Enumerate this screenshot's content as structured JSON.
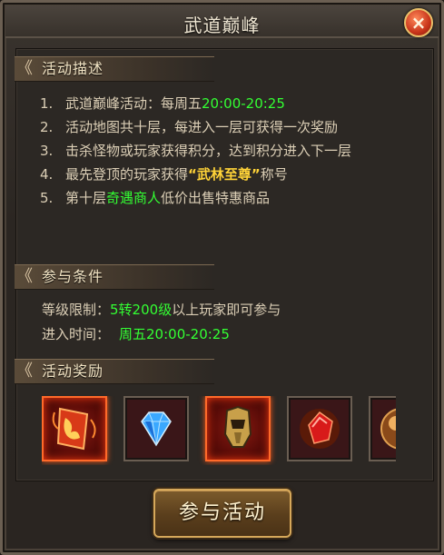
{
  "window": {
    "title": "武道巅峰"
  },
  "sections": {
    "description": "活动描述",
    "conditions": "参与条件",
    "rewards": "活动奖励"
  },
  "description_items": [
    {
      "num": "1.",
      "text": "武道巅峰活动：每周五",
      "highlight": "20:00-20:25",
      "suffix": ""
    },
    {
      "num": "2.",
      "text": "活动地图共十层，每进入一层可获得一次奖励"
    },
    {
      "num": "3.",
      "text": "击杀怪物或玩家获得积分，达到积分进入下一层"
    },
    {
      "num": "4.",
      "prefix": "最先登顶的玩家获得",
      "highlight": "“武林至尊”",
      "suffix": "称号"
    },
    {
      "num": "5.",
      "prefix": "第十层",
      "highlight": "奇遇商人",
      "suffix": "低价出售特惠商品"
    }
  ],
  "conditions": {
    "level_label": "等级限制：",
    "level_value": "5转200级",
    "level_suffix": "以上玩家即可参与",
    "time_label": "进入时间：",
    "time_value": "周五20:00-20:25"
  },
  "rewards": [
    {
      "icon": "fire-book-icon",
      "glow": true
    },
    {
      "icon": "blue-diamond-icon",
      "glow": false
    },
    {
      "icon": "gold-helmet-icon",
      "glow": true
    },
    {
      "icon": "red-gem-icon",
      "glow": false
    },
    {
      "icon": "orb-icon",
      "glow": false
    }
  ],
  "buttons": {
    "join": "参与活动",
    "close": "×"
  },
  "colors": {
    "highlight_green": "#33ff33",
    "highlight_gold": "#ffd338"
  }
}
